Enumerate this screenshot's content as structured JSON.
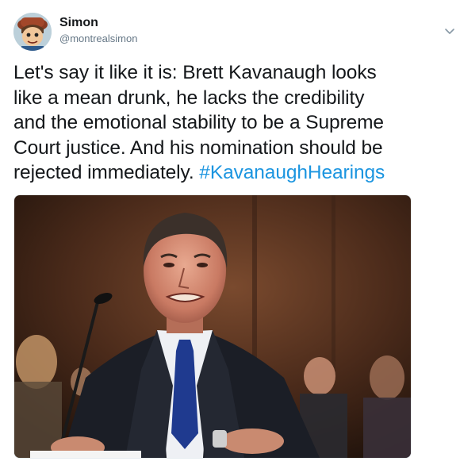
{
  "tweet": {
    "author": {
      "display_name": "Simon",
      "handle": "@montrealsimon"
    },
    "text_lines": [
      "Let's say it like it is: Brett Kavanaugh looks",
      "like a mean drunk, he lacks the credibility",
      "and the emotional stability to be a Supreme",
      "Court justice. And his nomination should be"
    ],
    "text_last_line": "rejected immediately.",
    "hashtag": "#KavanaughHearings",
    "icons": {
      "more": "chevron-down-icon",
      "avatar": "cartoon-avatar"
    },
    "colors": {
      "hashtag": "#1b95e0",
      "handle": "#657786",
      "text": "#14171a"
    }
  }
}
